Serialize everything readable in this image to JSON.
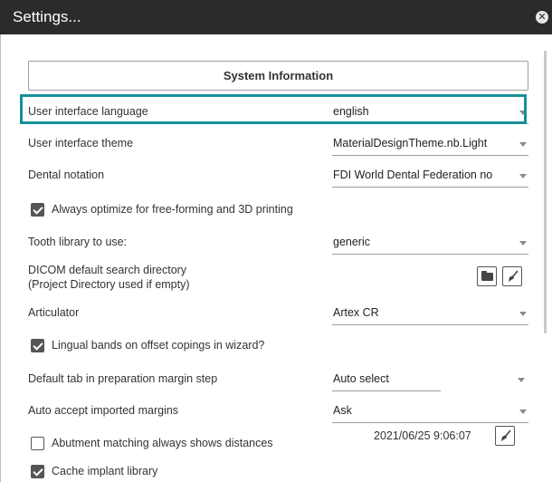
{
  "window": {
    "title": "Settings...",
    "close_icon": "close-icon"
  },
  "system_info_button": "System Information",
  "settings": {
    "ui_language": {
      "label": "User interface language",
      "value": "english"
    },
    "ui_theme": {
      "label": "User interface theme",
      "value": "MaterialDesignTheme.nb.Light"
    },
    "dental_notation": {
      "label": "Dental notation",
      "value": "FDI World Dental Federation no"
    },
    "optimize_freeform": {
      "label": "Always optimize for free-forming and 3D printing",
      "checked": true
    },
    "tooth_library": {
      "label": "Tooth library to use:",
      "value": "generic"
    },
    "dicom_dir": {
      "label_line1": "DICOM default search directory",
      "label_line2": "(Project Directory used if empty)"
    },
    "articulator": {
      "label": "Articulator",
      "value": "Artex CR"
    },
    "lingual_bands": {
      "label": "Lingual bands on offset copings in wizard?",
      "checked": true
    },
    "default_tab": {
      "label": "Default tab in preparation margin step",
      "value": "Auto select"
    },
    "auto_accept": {
      "label": "Auto accept imported margins",
      "value": "Ask"
    },
    "abutment_matching": {
      "label": "Abutment matching always shows distances",
      "checked": false
    },
    "cache_implant": {
      "label": "Cache implant library",
      "checked": true,
      "timestamp": "2021/06/25 9:06:07"
    }
  },
  "colors": {
    "titlebar": "#2b2b2b",
    "highlight": "#14909a"
  }
}
